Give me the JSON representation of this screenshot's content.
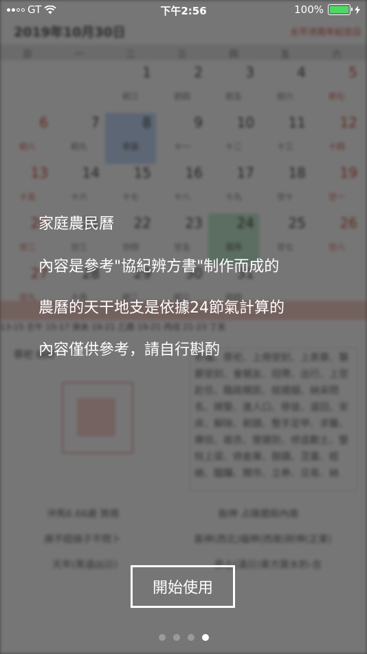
{
  "status_bar": {
    "carrier": "GT",
    "time": "下午2:56",
    "battery_percent": "100%",
    "battery_level": 1.0,
    "battery_color": "#4cd964"
  },
  "background_calendar": {
    "date_title": "2019年10月30日",
    "festival": "太平洋周年紀念日",
    "weekdays": [
      "日",
      "一",
      "二",
      "三",
      "四",
      "五",
      "六"
    ],
    "weeks": [
      [
        {
          "d": "",
          "l": ""
        },
        {
          "d": "",
          "l": ""
        },
        {
          "d": "1",
          "l": "初三"
        },
        {
          "d": "2",
          "l": "初四"
        },
        {
          "d": "3",
          "l": "初五"
        },
        {
          "d": "4",
          "l": "初六"
        },
        {
          "d": "5",
          "l": "初七"
        }
      ],
      [
        {
          "d": "6",
          "l": "初八"
        },
        {
          "d": "7",
          "l": "初九"
        },
        {
          "d": "8",
          "l": "寒露"
        },
        {
          "d": "9",
          "l": "十一"
        },
        {
          "d": "10",
          "l": "十二"
        },
        {
          "d": "11",
          "l": "十三"
        },
        {
          "d": "12",
          "l": "十四"
        }
      ],
      [
        {
          "d": "13",
          "l": "十五"
        },
        {
          "d": "14",
          "l": "十六"
        },
        {
          "d": "15",
          "l": "十七"
        },
        {
          "d": "16",
          "l": "十八"
        },
        {
          "d": "17",
          "l": "十九"
        },
        {
          "d": "18",
          "l": "廿十"
        },
        {
          "d": "19",
          "l": "廿一"
        }
      ],
      [
        {
          "d": "20",
          "l": "廿二"
        },
        {
          "d": "21",
          "l": "廿三"
        },
        {
          "d": "22",
          "l": "廿四"
        },
        {
          "d": "23",
          "l": "廿五"
        },
        {
          "d": "24",
          "l": "霜降"
        },
        {
          "d": "25",
          "l": "廿七"
        },
        {
          "d": "26",
          "l": "廿八"
        }
      ],
      [
        {
          "d": "27",
          "l": "廿九"
        },
        {
          "d": "28",
          "l": "十月"
        },
        {
          "d": "29",
          "l": "初二"
        },
        {
          "d": "30",
          "l": "初三"
        },
        {
          "d": "31",
          "l": "初四"
        },
        {
          "d": "",
          "l": ""
        },
        {
          "d": "",
          "l": ""
        }
      ]
    ],
    "ganzhi_row": "13-15 壬午  15-17 癸未        19-21 乙酉  19-21 丙戌  21-23 丁亥",
    "section_label": "祭祀   納財",
    "yi_text": "祈福、祭祀、上冊受封、上表章、襲爵受封、會親友、冠帶、出行、上官赴任、臨政親民、結婚姻、納采問名、嫁娶、進人口、移徙、遠回、安床、解除、剃頭、整手足甲、求醫、療目、裁衣、營建防、修造動土、豎柱上梁、修倉庫、鼓鑄、苫蓋、經絡、醞釀、開市、立券、交易、納",
    "info_lines": [
      "沖馬6.66歲 煞南",
      "胎神 占碓磨廁內南",
      "庚不經絡子不問卜",
      "喜神(西北)福神(西南)財神(正東)",
      "天牢(黑道凶日)",
      "昴土(滿日)東方箕水豹-吉"
    ]
  },
  "intro": {
    "title": "家庭農民曆",
    "lines": [
      "內容是參考\"協紀辨方書\"制作而成的",
      "農曆的天干地支是依據24節氣計算的",
      "內容僅供參考，請自行斟酌"
    ]
  },
  "start_button": {
    "label": "開始使用"
  },
  "pagination": {
    "total": 4,
    "active": 4
  }
}
